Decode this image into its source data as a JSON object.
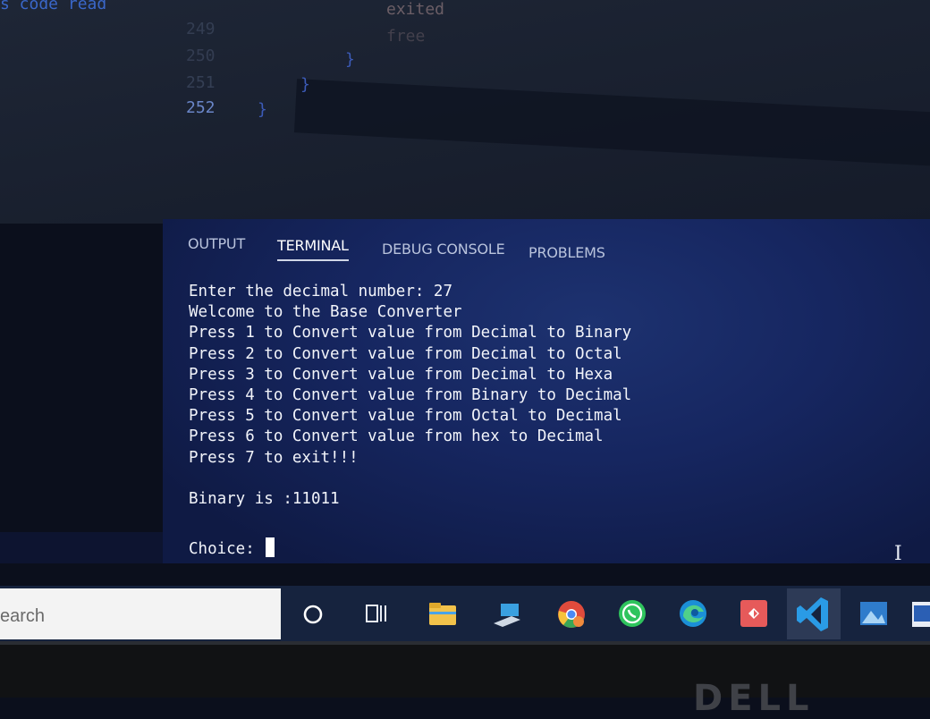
{
  "editor": {
    "top_text": "exited",
    "top_text2": "free",
    "partial_left": "s code read",
    "line_numbers": [
      "249",
      "250",
      "251",
      "252"
    ],
    "active_line": "252",
    "brace": "}"
  },
  "panel": {
    "tabs": [
      {
        "label": "OUTPUT",
        "active": false
      },
      {
        "label": "TERMINAL",
        "active": true
      },
      {
        "label": "DEBUG CONSOLE",
        "active": false
      },
      {
        "label": "PROBLEMS",
        "active": false
      }
    ],
    "terminal_lines": [
      "Enter the decimal number: 27",
      "Welcome to the Base Converter",
      "Press 1 to Convert value from Decimal to Binary",
      "Press 2 to Convert value from Decimal to Octal",
      "Press 3 to Convert value from Decimal to Hexa",
      "Press 4 to Convert value from Binary to Decimal",
      "Press 5 to Convert value from Octal to Decimal",
      "Press 6 to Convert value from hex to Decimal",
      "Press 7 to exit!!!",
      "",
      "Binary is :11011"
    ],
    "prompt": "Choice: "
  },
  "taskbar": {
    "search_text": "earch",
    "icons": [
      "cortana-icon",
      "task-view-icon",
      "file-explorer-icon",
      "network-app-icon",
      "chrome-icon",
      "whatsapp-icon",
      "edge-icon",
      "git-app-icon",
      "vscode-icon",
      "photos-icon",
      "word-icon"
    ]
  },
  "bezel": {
    "logo": "DELL"
  },
  "colors": {
    "panel_bg": "#162660",
    "taskbar_bg": "#16233e",
    "text": "#f2f4fa"
  }
}
